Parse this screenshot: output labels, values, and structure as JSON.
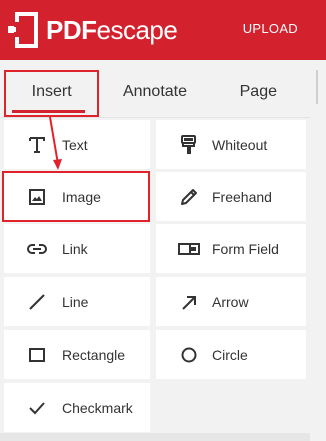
{
  "header": {
    "brand_bold": "PDF",
    "brand_light": "escape",
    "upload_label": "UPLOAD",
    "brand_color": "#d3212e"
  },
  "tabs": [
    {
      "label": "Insert",
      "active": true
    },
    {
      "label": "Annotate",
      "active": false
    },
    {
      "label": "Page",
      "active": false
    }
  ],
  "tools": [
    {
      "label": "Text",
      "icon": "text-t-icon"
    },
    {
      "label": "Whiteout",
      "icon": "whiteout-icon"
    },
    {
      "label": "Image",
      "icon": "image-icon"
    },
    {
      "label": "Freehand",
      "icon": "pencil-icon"
    },
    {
      "label": "Link",
      "icon": "link-icon"
    },
    {
      "label": "Form Field",
      "icon": "form-field-icon"
    },
    {
      "label": "Line",
      "icon": "line-icon"
    },
    {
      "label": "Arrow",
      "icon": "arrow-icon"
    },
    {
      "label": "Rectangle",
      "icon": "rectangle-icon"
    },
    {
      "label": "Circle",
      "icon": "circle-icon"
    },
    {
      "label": "Checkmark",
      "icon": "checkmark-icon"
    }
  ],
  "annotation_color": "#e0222b"
}
